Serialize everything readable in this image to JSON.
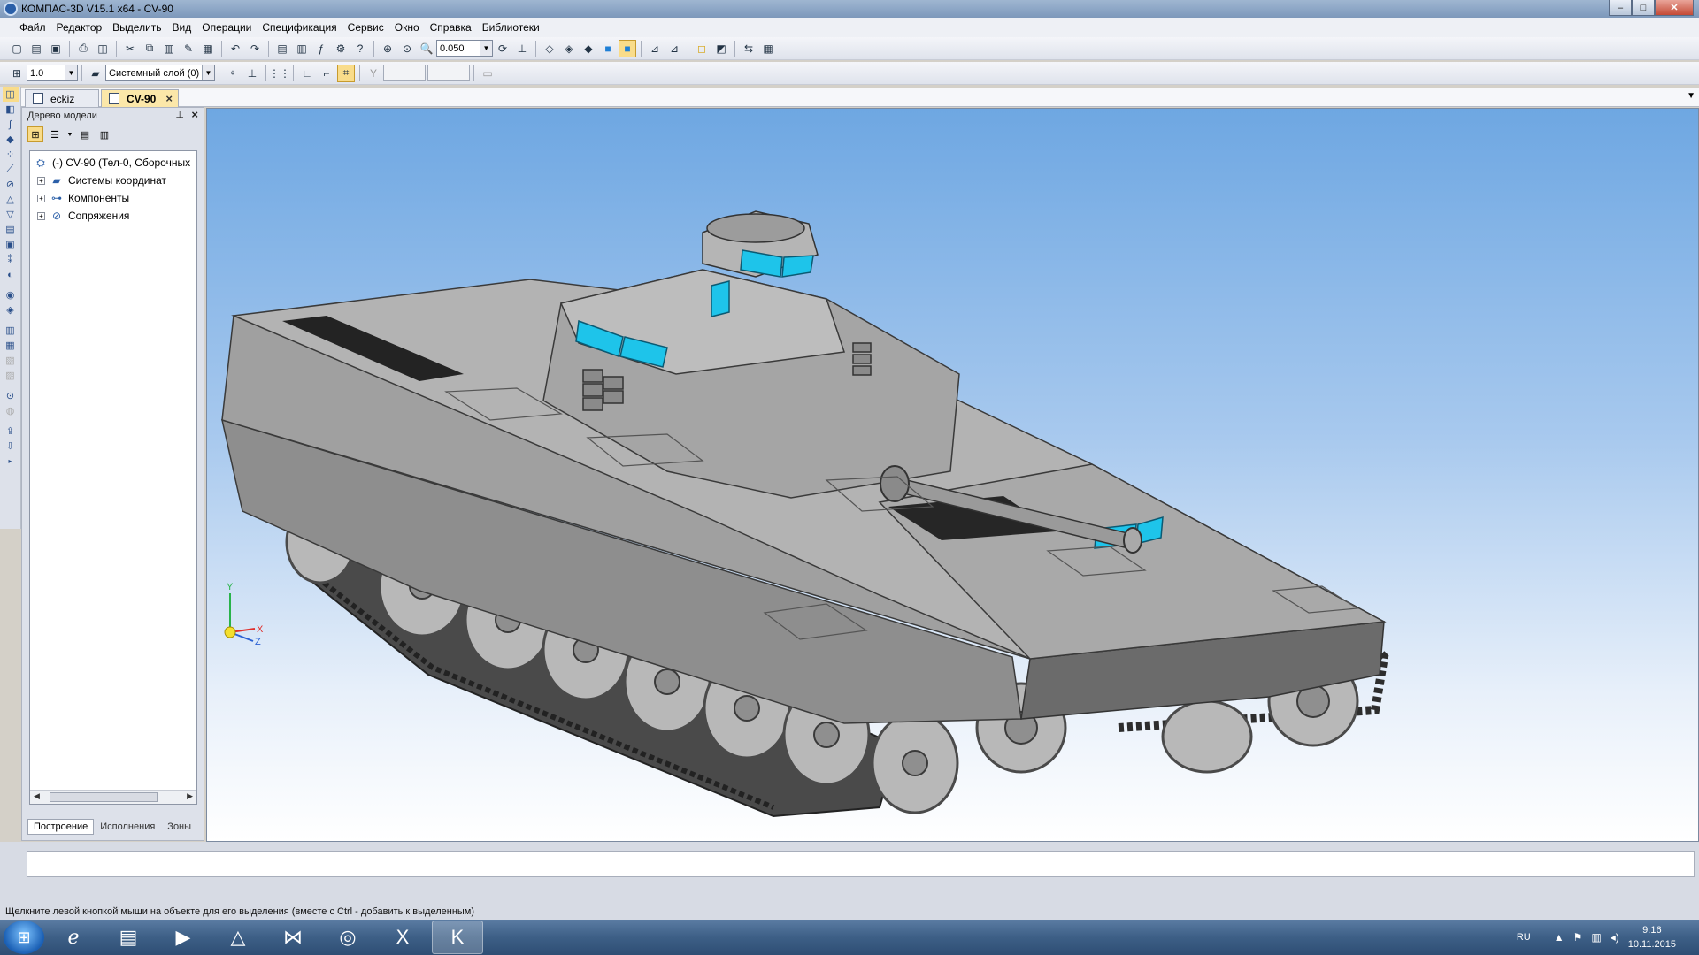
{
  "window": {
    "title": "КОМПАС-3D V15.1 x64 - CV-90",
    "minimize": "–",
    "maximize": "□",
    "close": "✕"
  },
  "menu": [
    "Файл",
    "Редактор",
    "Выделить",
    "Вид",
    "Операции",
    "Спецификация",
    "Сервис",
    "Окно",
    "Справка",
    "Библиотеки"
  ],
  "toolbar": {
    "zoom_value": "0.050",
    "step_value": "1.0",
    "layer_value": "Системный слой (0)"
  },
  "tabs": [
    {
      "label": "eckiz",
      "active": false
    },
    {
      "label": "CV-90",
      "active": true,
      "close": "×"
    }
  ],
  "tree": {
    "title": "Дерево модели",
    "pin": "⊥",
    "close": "×",
    "nodes": [
      {
        "label": "(-) CV-90 (Тел-0, Сборочных"
      },
      {
        "label": "Системы координат"
      },
      {
        "label": "Компоненты"
      },
      {
        "label": "Сопряжения"
      }
    ],
    "panel_tabs": [
      "Построение",
      "Исполнения",
      "Зоны"
    ]
  },
  "axes": {
    "x": "X",
    "y": "Y",
    "z": "Z"
  },
  "status": "Щелкните левой кнопкой мыши на объекте для его выделения (вместе с Ctrl - добавить к выделенным)",
  "taskbar": {
    "lang": "RU",
    "time": "9:16",
    "date": "10.11.2015"
  },
  "colors": {
    "viewport_top": "#6ea7e2",
    "viewport_bottom": "#ffffff",
    "model_gray": "#9c9c9c",
    "glass_cyan": "#1ec4ea",
    "active_tab": "#fbe7a9"
  }
}
